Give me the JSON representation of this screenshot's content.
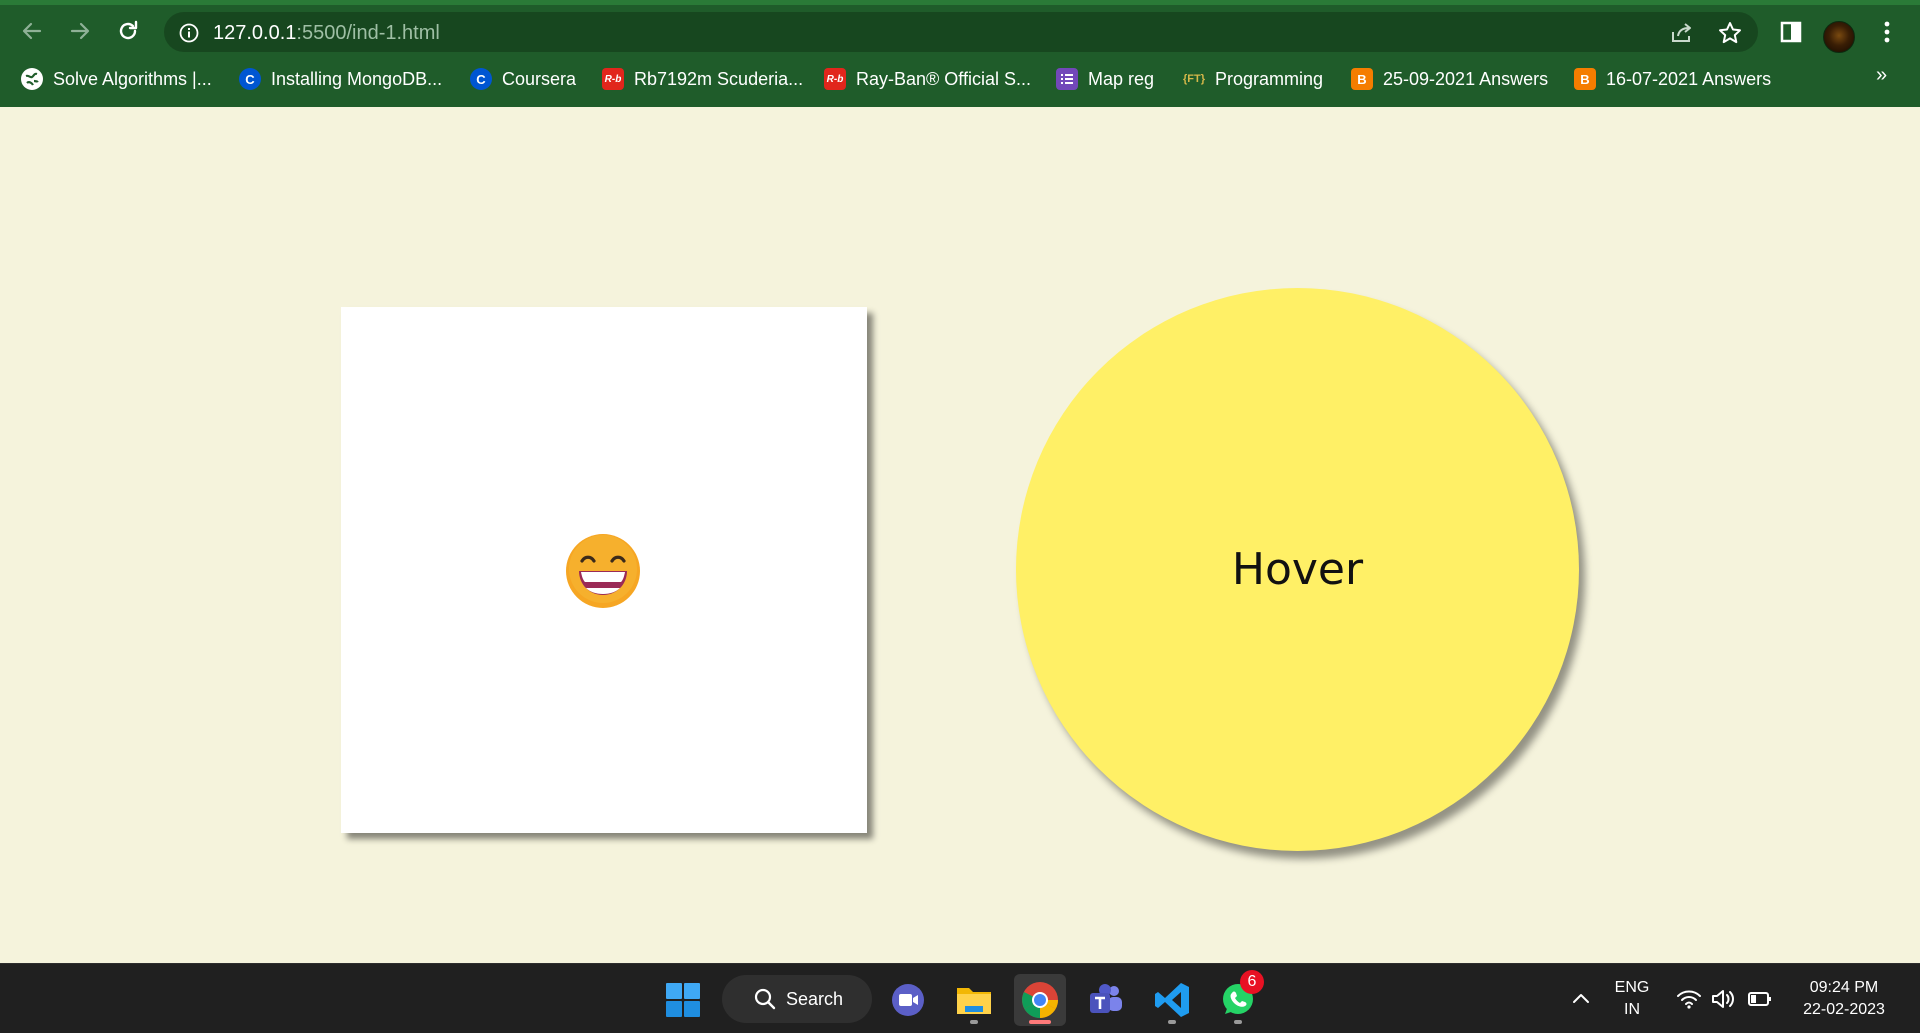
{
  "browser": {
    "url_host": "127.0.0.1",
    "url_path": ":5500/ind-1.html",
    "bookmarks": [
      {
        "label": "Solve Algorithms |...",
        "icon": "globe-icon",
        "color": "#ffffff"
      },
      {
        "label": "Installing MongoDB...",
        "icon": "coursera-icon",
        "color": "#0056d2"
      },
      {
        "label": "Coursera",
        "icon": "coursera-icon",
        "color": "#0056d2"
      },
      {
        "label": "Rb7192m Scuderia...",
        "icon": "rayban-icon",
        "color": "#e1261c"
      },
      {
        "label": "Ray-Ban® Official S...",
        "icon": "rayban-icon",
        "color": "#e1261c"
      },
      {
        "label": "Map reg",
        "icon": "forms-icon",
        "color": "#7248b9"
      },
      {
        "label": "Programming",
        "icon": "code-icon",
        "color": "#1f5c2a"
      },
      {
        "label": "25-09-2021 Answers",
        "icon": "blogger-icon",
        "color": "#f57d00"
      },
      {
        "label": "16-07-2021 Answers",
        "icon": "blogger-icon",
        "color": "#f57d00"
      }
    ],
    "more_bookmarks": "»"
  },
  "page": {
    "emoji": "grinning-face-icon",
    "circle_label": "Hover",
    "circle_color": "#fff066",
    "background_color": "#f5f3dc"
  },
  "taskbar": {
    "search_label": "Search",
    "whatsapp_badge": "6",
    "language_top": "ENG",
    "language_bottom": "IN",
    "time": "09:24 PM",
    "date": "22-02-2023"
  }
}
